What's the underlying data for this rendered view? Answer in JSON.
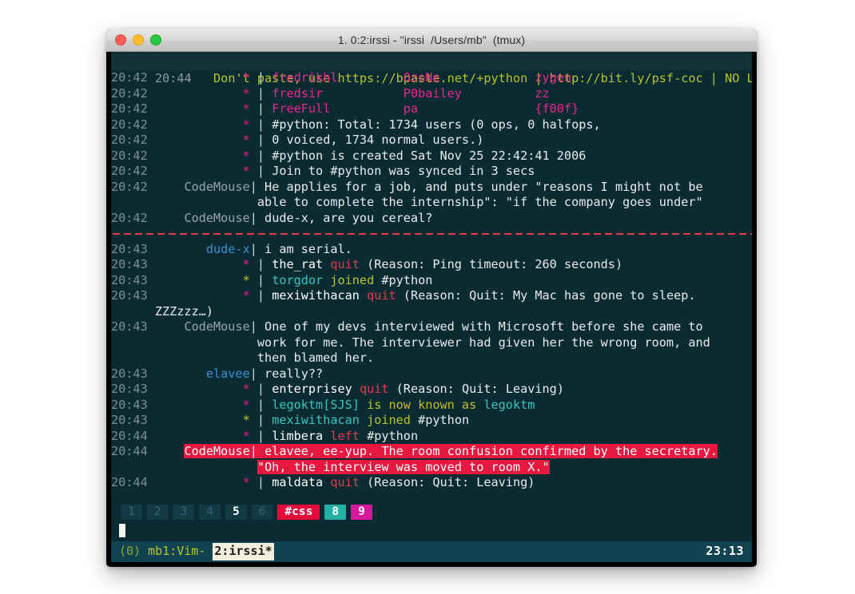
{
  "window": {
    "title": "1. 0:2:irssi - \"irssi  /Users/mb\"  (tmux)",
    "traffic_lights": [
      "close",
      "minimize",
      "maximize"
    ]
  },
  "terminal": {
    "topic": {
      "time": "20:44",
      "text": "Don't paste, use https://bpaste.net/+python | http://bit.ly/psf-coc | NO LOL"
    },
    "lines": [
      {
        "type": "names",
        "time": "20:42",
        "star": "pink",
        "cols": [
          "fredrikhl",
          "OzoNe",
          "zygen"
        ]
      },
      {
        "type": "names",
        "time": "20:42",
        "star": "pink",
        "cols": [
          "fredsir",
          "P0bailey",
          "zz"
        ]
      },
      {
        "type": "names",
        "time": "20:42",
        "star": "pink",
        "cols": [
          "FreeFull",
          "pa",
          "{f00f}"
        ]
      },
      {
        "type": "plain",
        "time": "20:42",
        "star": "pink",
        "text": "#python: Total: 1734 users (0 ops, 0 halfops,"
      },
      {
        "type": "plain",
        "time": "20:42",
        "star": "pink",
        "text": "0 voiced, 1734 normal users.)"
      },
      {
        "type": "plain",
        "time": "20:42",
        "star": "pink",
        "text": "#python is created Sat Nov 25 22:42:41 2006"
      },
      {
        "type": "plain",
        "time": "20:42",
        "star": "pink",
        "text": "Join to #python was synced in 3 secs"
      },
      {
        "type": "msg",
        "time": "20:42",
        "nick": "CodeMouse",
        "nick_color": "grey",
        "text": "He applies for a job, and puts under \"reasons I might not be"
      },
      {
        "type": "cont",
        "text": "able to complete the internship\": \"if the company goes under\""
      },
      {
        "type": "msg",
        "time": "20:42",
        "nick": "CodeMouse",
        "nick_color": "grey",
        "text": "dude-x, are you cereal?"
      },
      {
        "type": "separator"
      },
      {
        "type": "msg",
        "time": "20:43",
        "nick": "dude-x",
        "nick_color": "blue",
        "text": "i am serial."
      },
      {
        "type": "event",
        "time": "20:43",
        "star": "pink",
        "who": "the_rat",
        "who_color": "white",
        "verb": "quit",
        "verb_color": "red",
        "rest": " (Reason: Ping timeout: 260 seconds)"
      },
      {
        "type": "event",
        "time": "20:43",
        "star": "green",
        "who": "torgdor",
        "who_color": "cyan",
        "verb": "joined",
        "verb_color": "olive",
        "rest": " #python"
      },
      {
        "type": "event",
        "time": "20:43",
        "star": "pink",
        "who": "mexiwithacan",
        "who_color": "white",
        "verb": "quit",
        "verb_color": "red",
        "rest": " (Reason: Quit: My Mac has gone to sleep."
      },
      {
        "type": "raw",
        "text": "      ZZZzzz…)"
      },
      {
        "type": "msg",
        "time": "20:43",
        "nick": "CodeMouse",
        "nick_color": "grey",
        "text": "One of my devs interviewed with Microsoft before she came to"
      },
      {
        "type": "cont",
        "text": "work for me. The interviewer had given her the wrong room, and"
      },
      {
        "type": "cont",
        "text": "then blamed her."
      },
      {
        "type": "msg",
        "time": "20:43",
        "nick": "elavee",
        "nick_color": "blue",
        "text": "really??"
      },
      {
        "type": "event",
        "time": "20:43",
        "star": "pink",
        "who": "enterprisey",
        "who_color": "white",
        "verb": "quit",
        "verb_color": "red",
        "rest": " (Reason: Quit: Leaving)"
      },
      {
        "type": "nickchange",
        "time": "20:43",
        "star": "pink",
        "who": "legoktm[SJS]",
        "who_color": "cyan",
        "mid1": " is ",
        "mid1_color": "olive",
        "mid2": "now known as",
        "mid2_color": "yellow",
        "tail": " legoktm",
        "tail_color": "cyan"
      },
      {
        "type": "event",
        "time": "20:43",
        "star": "green",
        "who": "mexiwithacan",
        "who_color": "cyan",
        "verb": "joined",
        "verb_color": "olive",
        "rest": " #python"
      },
      {
        "type": "event",
        "time": "20:44",
        "star": "pink",
        "who": "limbera",
        "who_color": "white",
        "verb": "left",
        "verb_color": "red",
        "rest": " #python"
      },
      {
        "type": "highlight",
        "time": "20:44",
        "nick": "CodeMouse",
        "text": "elavee, ee-yup. The room confusion confirmed by the secretary."
      },
      {
        "type": "highlight_cont",
        "text": "\"Oh, the interview was moved to room X.\""
      },
      {
        "type": "event",
        "time": "20:44",
        "star": "pink",
        "who": "maldata",
        "who_color": "white",
        "verb": "quit",
        "verb_color": "red",
        "rest": " (Reason: Quit: Leaving)"
      }
    ],
    "window_tabs": [
      {
        "label": "1",
        "state": "dim"
      },
      {
        "label": "2",
        "state": "dim"
      },
      {
        "label": "3",
        "state": "dim"
      },
      {
        "label": "4",
        "state": "dim"
      },
      {
        "label": "5",
        "state": "active"
      },
      {
        "label": "6",
        "state": "dim"
      },
      {
        "label": "#css",
        "state": "red"
      },
      {
        "label": "8",
        "state": "teal"
      },
      {
        "label": "9",
        "state": "mag"
      }
    ],
    "prompt": {
      "value": ""
    }
  },
  "tmux_status": {
    "session": "(0)",
    "window_vim": " mb1:Vim- ",
    "window_active": "2:irssi*",
    "clock": "23:13"
  },
  "colors": {
    "terminal_bg": "#0b2b33",
    "topic_bg": "#123038",
    "highlight_bg": "#e8173f",
    "tmux_bg": "#124350",
    "accent_pink": "#e31c79",
    "accent_olive": "#b7c528",
    "accent_red": "#e53a4e",
    "accent_teal": "#22b0a6",
    "accent_magenta": "#d6199c"
  }
}
